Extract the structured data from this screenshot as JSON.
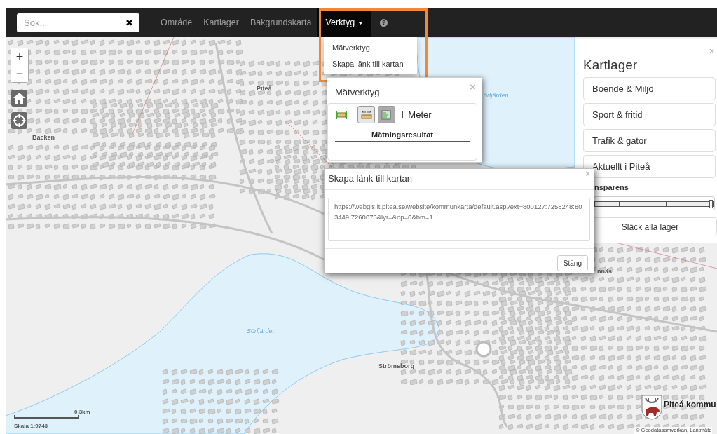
{
  "navbar": {
    "search": {
      "placeholder": "Sök..."
    },
    "clear_button": "✖",
    "menu": [
      {
        "label": "Område",
        "kind": "link",
        "selected": false
      },
      {
        "label": "Kartlager",
        "kind": "link",
        "selected": false
      },
      {
        "label": "Bakgrundskarta",
        "kind": "link",
        "selected": false
      },
      {
        "label": "Verktyg",
        "kind": "dropdown",
        "selected": true
      },
      {
        "label": "?",
        "kind": "help",
        "selected": false
      }
    ]
  },
  "dropdown": {
    "highlighted": true,
    "items": [
      "Mätverktyg",
      "Skapa länk till kartan"
    ]
  },
  "map_controls": {
    "zoom_in": "+",
    "zoom_out": "−"
  },
  "map_labels": [
    {
      "text": "Piteå",
      "kind": "place"
    },
    {
      "text": "Backen",
      "kind": "place"
    },
    {
      "text": "örfjärden",
      "kind": "water"
    },
    {
      "text": "Sörfjärden",
      "kind": "water"
    },
    {
      "text": "Strömsborg",
      "kind": "place"
    },
    {
      "text": "nnäs",
      "kind": "place"
    }
  ],
  "measure_panel": {
    "title": "Mätverktyg",
    "close": "×",
    "tools": [
      {
        "kind": "plain"
      },
      {
        "kind": "button",
        "selected": true
      },
      {
        "kind": "button",
        "selected": false
      }
    ],
    "separator": "|",
    "unit": "Meter",
    "result_heading": "Mätningsresultat"
  },
  "link_dialog": {
    "title": "Skapa länk till kartan",
    "close": "×",
    "url": "https://webgis.it.pitea.se/website/kommunkarta/default.asp?ext=800127:7258248:803449:7260073&lyr=&op=0&bm=1",
    "close_button": "Stäng"
  },
  "layers_panel": {
    "close": "×",
    "title": "Kartlager",
    "groups": [
      "Boende & Miljö",
      "Sport & fritid",
      "Trafik & gator",
      "Aktuellt i Piteå"
    ],
    "transparency": {
      "label": "nsparens",
      "level": 0.98
    },
    "clear_button": "Släck alla lager"
  },
  "scale": {
    "distance": "0.3km",
    "ratio": "Skala 1:9743"
  },
  "logo": {
    "text": "Piteå kommu"
  },
  "attribution": "© Geodatasamverkan, Lantmäte"
}
